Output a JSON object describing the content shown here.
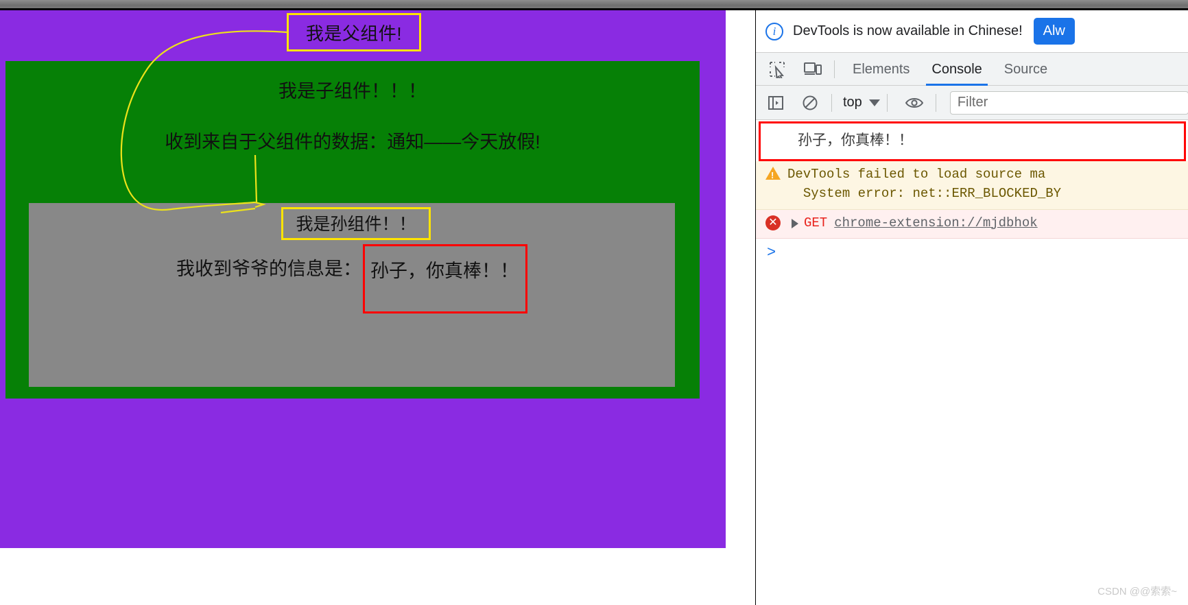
{
  "page": {
    "parent_title": "我是父组件!",
    "child_title": "我是子组件！！！",
    "child_data": "收到来自于父组件的数据：通知——今天放假!",
    "grandchild_title": "我是孙组件！！",
    "grandchild_msg_label": "我收到爷爷的信息是：",
    "grandchild_msg_value": "孙子，你真棒！！",
    "colors": {
      "parent_bg": "#8A2BE2",
      "child_bg": "#068006",
      "grandchild_bg": "#888888",
      "highlight_yellow": "#FFE400",
      "highlight_red": "#FF0000"
    }
  },
  "devtools": {
    "banner": {
      "text": "DevTools is now available in Chinese!",
      "button_label": "Alw",
      "icon": "info-icon"
    },
    "tabbar": {
      "inspect_icon": "inspect-element-icon",
      "device_icon": "device-toolbar-icon",
      "tabs": [
        {
          "label": "Elements",
          "active": false
        },
        {
          "label": "Console",
          "active": true
        },
        {
          "label": "Source",
          "active": false
        }
      ]
    },
    "toolbar": {
      "sidebar_icon": "console-sidebar-icon",
      "clear_icon": "clear-console-icon",
      "context": "top",
      "context_caret": "chevron-down-icon",
      "eye_icon": "live-expression-icon",
      "filter_placeholder": "Filter",
      "filter_value": ""
    },
    "console": {
      "messages": [
        {
          "kind": "user",
          "text": "孙子，你真棒！！"
        },
        {
          "kind": "warn",
          "icon": "warning-icon",
          "line1": "DevTools failed to load source ma",
          "line2": "System error: net::ERR_BLOCKED_BY"
        },
        {
          "kind": "error",
          "icon": "error-icon",
          "disclosure": "expand-triangle-icon",
          "method": "GET",
          "url": "chrome-extension://mjdbhok"
        }
      ],
      "prompt": ">"
    },
    "watermark": "CSDN @@索索~"
  }
}
